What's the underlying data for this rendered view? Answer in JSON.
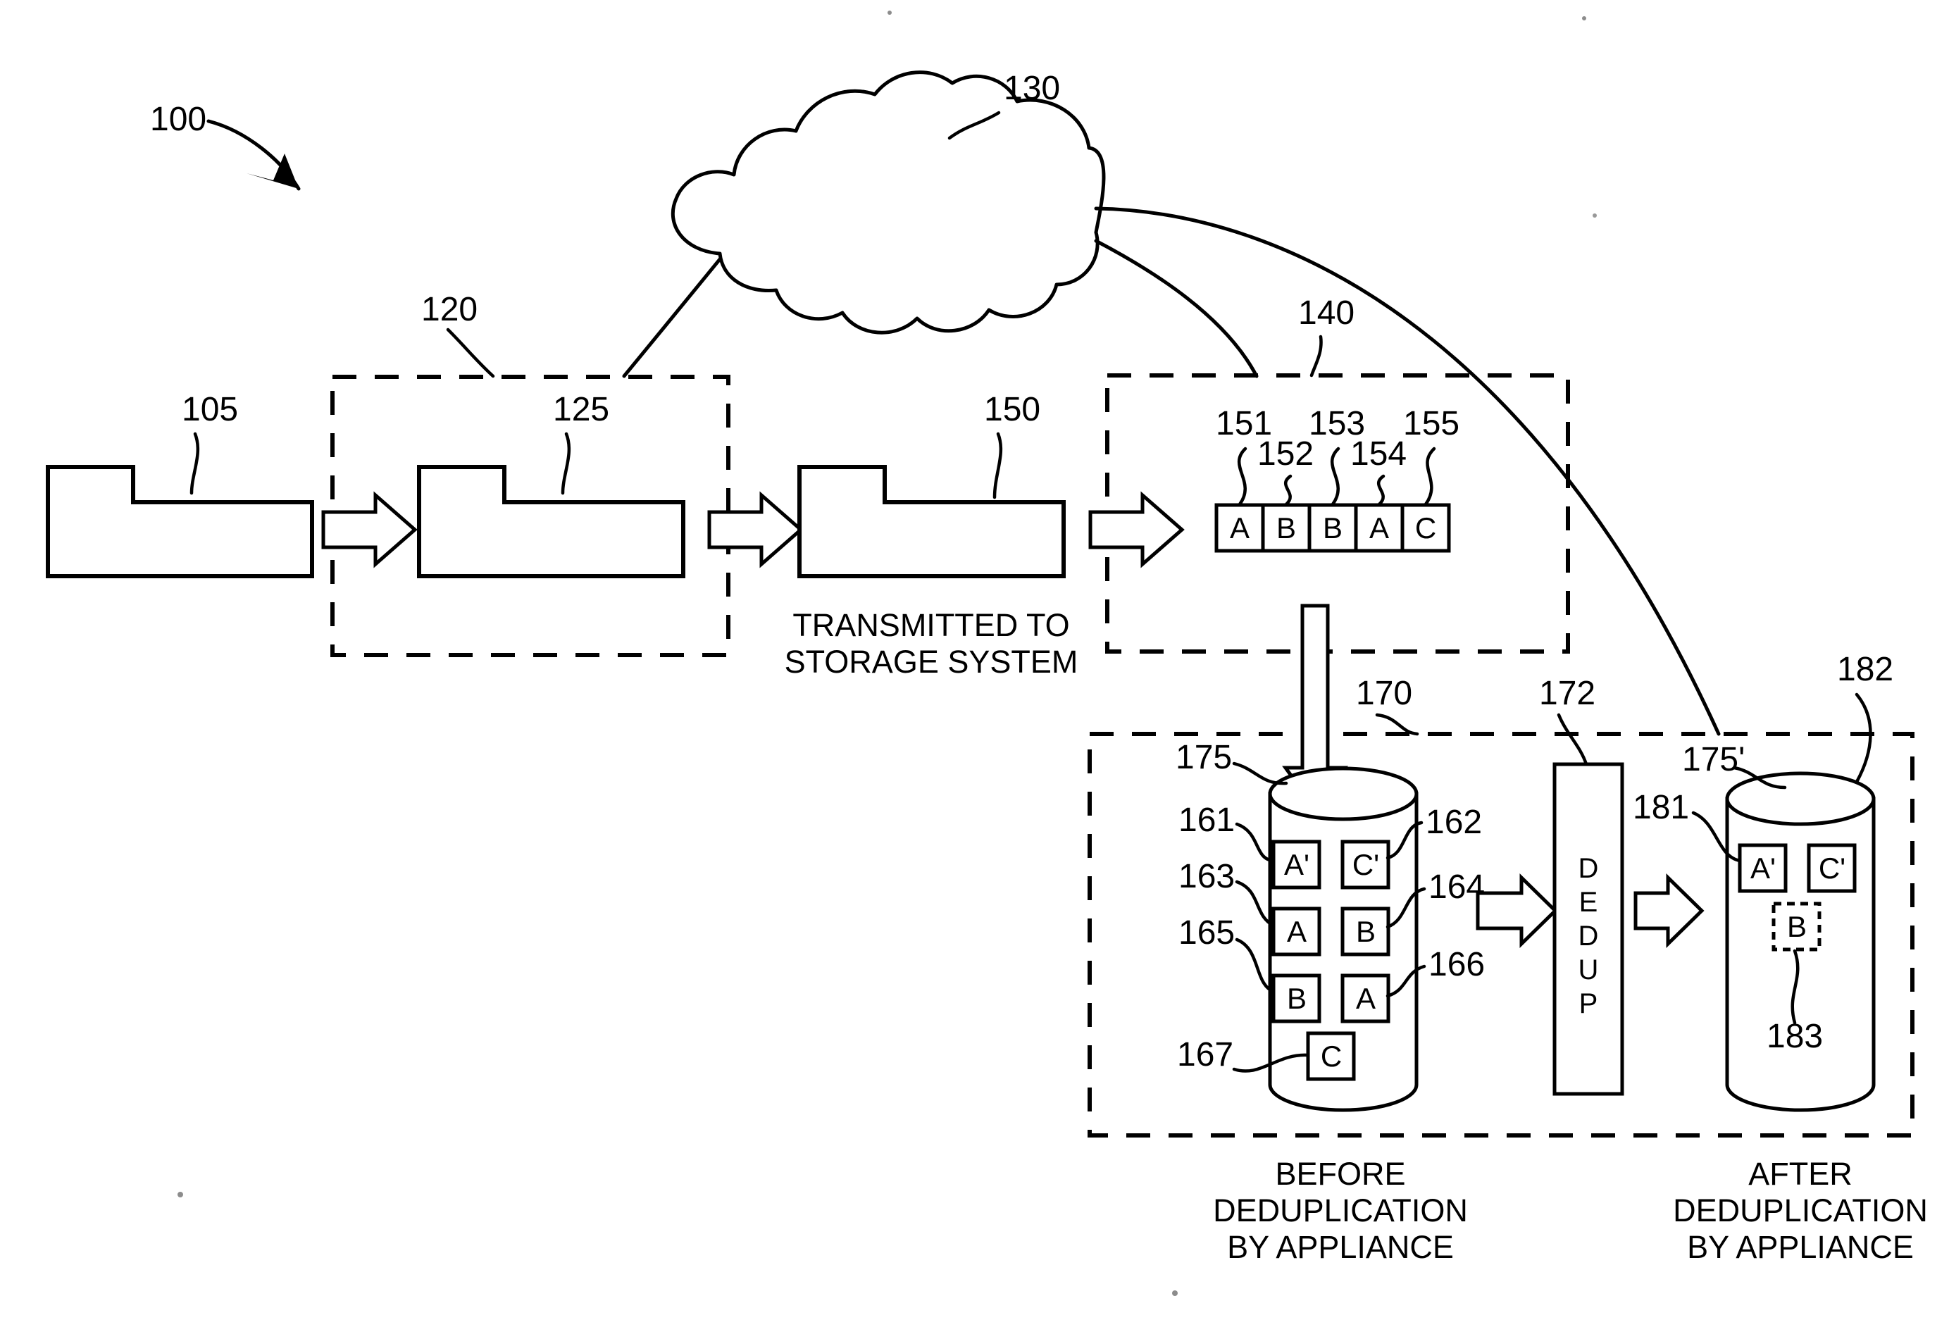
{
  "figure": {
    "system_ref": "100",
    "refs": {
      "source_document": "105",
      "client_boundary": "120",
      "client_document": "125",
      "network_cloud": "130",
      "appliance_boundary": "140",
      "transmitted_document": "150",
      "chunk_1": "151",
      "chunk_2": "152",
      "chunk_3": "153",
      "chunk_4": "154",
      "chunk_5": "155",
      "stored_block_1": "161",
      "stored_block_2": "162",
      "stored_block_3": "163",
      "stored_block_4": "164",
      "stored_block_5": "165",
      "stored_block_6": "166",
      "stored_block_7": "167",
      "storage_boundary": "170",
      "dedup_engine": "172",
      "store_before": "175",
      "store_after": "175'",
      "kept_block_1": "181",
      "store_after_alt": "182",
      "removed_block": "183"
    }
  },
  "labels": {
    "transmitted_line1": "TRANSMITTED TO",
    "transmitted_line2": "STORAGE SYSTEM",
    "before_line1": "BEFORE",
    "before_line2": "DEDUPLICATION",
    "before_line3": "BY APPLIANCE",
    "after_line1": "AFTER",
    "after_line2": "DEDUPLICATION",
    "after_line3": "BY APPLIANCE",
    "dedup_letters": [
      "D",
      "E",
      "D",
      "U",
      "P"
    ]
  },
  "chunk_stream": {
    "blocks": [
      {
        "label": "A",
        "ref": "151"
      },
      {
        "label": "B",
        "ref": "152"
      },
      {
        "label": "B",
        "ref": "153"
      },
      {
        "label": "A",
        "ref": "154"
      },
      {
        "label": "C",
        "ref": "155"
      }
    ]
  },
  "before_store": {
    "blocks": [
      {
        "label": "A'",
        "ref": "161",
        "style": "solid"
      },
      {
        "label": "C'",
        "ref": "162",
        "style": "solid"
      },
      {
        "label": "A",
        "ref": "163",
        "style": "solid"
      },
      {
        "label": "B",
        "ref": "164",
        "style": "solid"
      },
      {
        "label": "B",
        "ref": "165",
        "style": "solid"
      },
      {
        "label": "A",
        "ref": "166",
        "style": "solid"
      },
      {
        "label": "C",
        "ref": "167",
        "style": "solid"
      }
    ]
  },
  "after_store": {
    "blocks": [
      {
        "label": "A'",
        "ref": "181",
        "style": "solid"
      },
      {
        "label": "C'",
        "ref": "",
        "style": "solid"
      },
      {
        "label": "B",
        "ref": "183",
        "style": "dashed"
      }
    ]
  },
  "colors": {
    "ink": "#000000",
    "paper": "#ffffff"
  }
}
